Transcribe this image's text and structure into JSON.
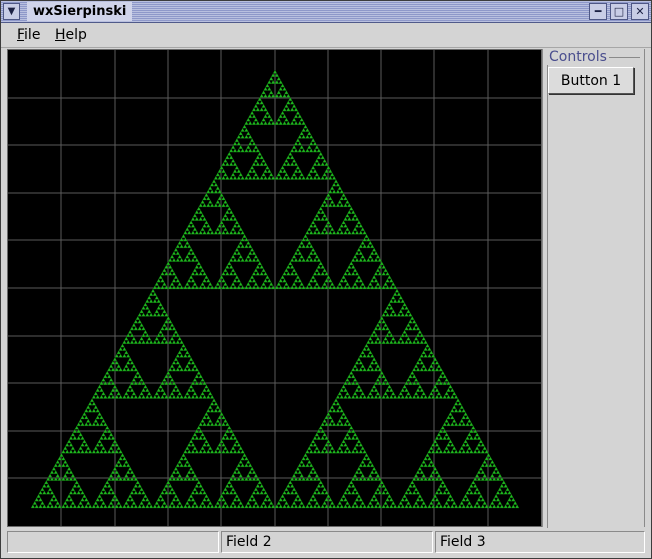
{
  "window": {
    "title": "wxSierpinski"
  },
  "titlebar_icons": {
    "menu": "chevron-down-icon",
    "minimize": "minimize-icon",
    "maximize": "maximize-icon",
    "close": "close-icon"
  },
  "menubar": {
    "items": [
      {
        "mnemonic": "F",
        "rest": "ile"
      },
      {
        "mnemonic": "H",
        "rest": "elp"
      }
    ]
  },
  "canvas": {
    "background": "#000000",
    "grid_color": "#5a5a5a",
    "fractal_color": "#1fb81f",
    "fractal": "sierpinski-triangle"
  },
  "controls": {
    "group_label": "Controls",
    "button1_label": "Button 1"
  },
  "statusbar": {
    "fields": [
      "",
      "Field 2",
      "Field 3"
    ]
  }
}
